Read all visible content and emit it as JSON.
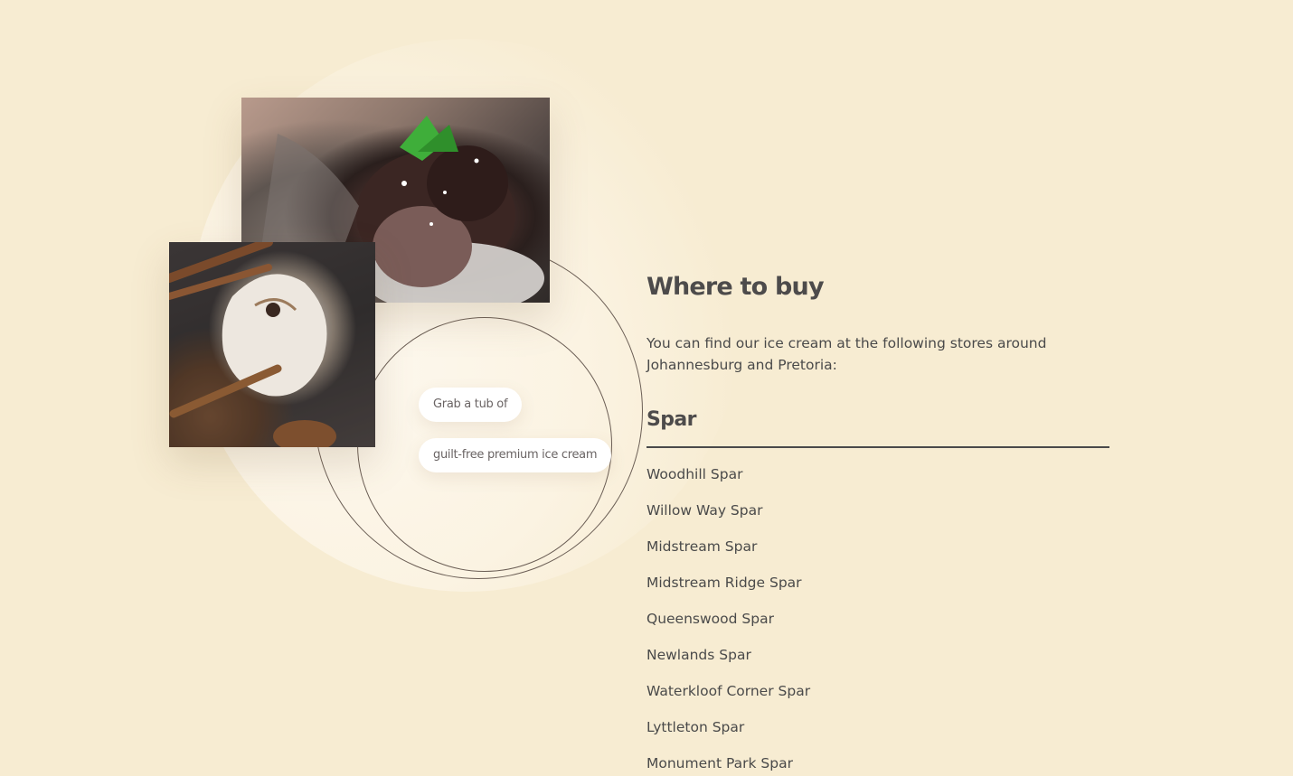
{
  "hero": {
    "pill_line_1": "Grab a tub of",
    "pill_line_2": "guilt-free premium ice cream",
    "images": [
      {
        "icon": "chocolate-ice-cream-photo"
      },
      {
        "icon": "vanilla-cinnamon-ice-cream-photo"
      }
    ]
  },
  "where_to_buy": {
    "title": "Where to buy",
    "intro": "You can find our ice cream at the following stores around Johannesburg and Pretoria:",
    "store_group": "Spar",
    "stores": [
      "Woodhill Spar",
      "Willow Way Spar",
      "Midstream Spar",
      "Midstream Ridge Spar",
      "Queenswood Spar",
      "Newlands Spar",
      "Waterkloof Corner Spar",
      "Lyttleton Spar",
      "Monument Park Spar"
    ]
  },
  "colors": {
    "background": "#f7ecd2",
    "text": "#4a4a4a",
    "pill": "#ffffff"
  }
}
